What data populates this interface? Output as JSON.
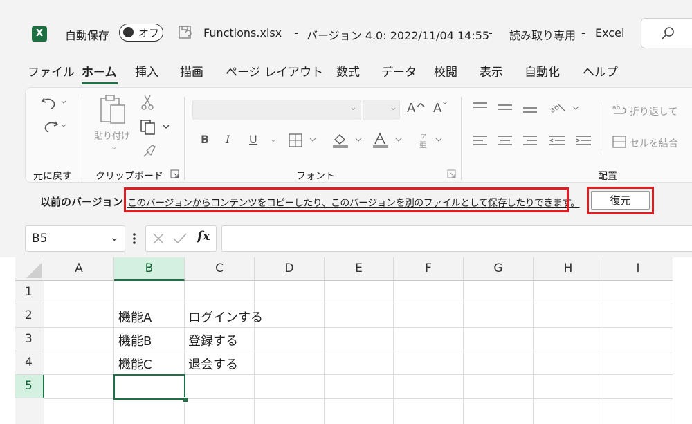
{
  "title_bar": {
    "app_icon": "excel-icon",
    "autosave_label": "自動保存",
    "autosave_state": "オフ",
    "file_name": "Functions.xlsx",
    "separator": "-",
    "version_info": "バージョン 4.0: 2022/11/04 14:55",
    "mode": "読み取り専用",
    "app_name": "Excel"
  },
  "menu": {
    "tabs": [
      "ファイル",
      "ホーム",
      "挿入",
      "描画",
      "ページ レイアウト",
      "数式",
      "データ",
      "校閲",
      "表示",
      "自動化",
      "ヘルプ"
    ],
    "active": "ホーム"
  },
  "ribbon": {
    "undo_group_label": "元に戻す",
    "clipboard_group_label": "クリップボード",
    "paste_label": "貼り付け",
    "font_group_label": "フォント",
    "alignment_group_label": "配置",
    "wrap_text_label": "折り返して",
    "merge_label": "セルを結合",
    "bold_label": "B",
    "italic_label": "I",
    "underline_label": "U",
    "grow_font_label": "A^",
    "shrink_font_label": "Aˇ"
  },
  "version_bar": {
    "label": "以前のバージョン",
    "message": "このバージョンからコンテンツをコピーしたり、このバージョンを別のファイルとして保存したりできます。",
    "restore_button": "復元"
  },
  "formula_bar": {
    "name_box": "B5",
    "fx_label": "fx",
    "formula": ""
  },
  "sheet": {
    "columns": [
      "A",
      "B",
      "C",
      "D",
      "E",
      "F",
      "G",
      "H",
      "I"
    ],
    "rows": [
      "1",
      "2",
      "3",
      "4",
      "5"
    ],
    "selected_cell": "B5",
    "cells": {
      "B2": "機能A",
      "C2": "ログインする",
      "B3": "機能B",
      "C3": "登録する",
      "B4": "機能C",
      "C4": "退会する"
    }
  },
  "colors": {
    "excel_green": "#1e7145",
    "highlight_red": "#e11b22",
    "chrome_gray": "#f3f3f3"
  }
}
